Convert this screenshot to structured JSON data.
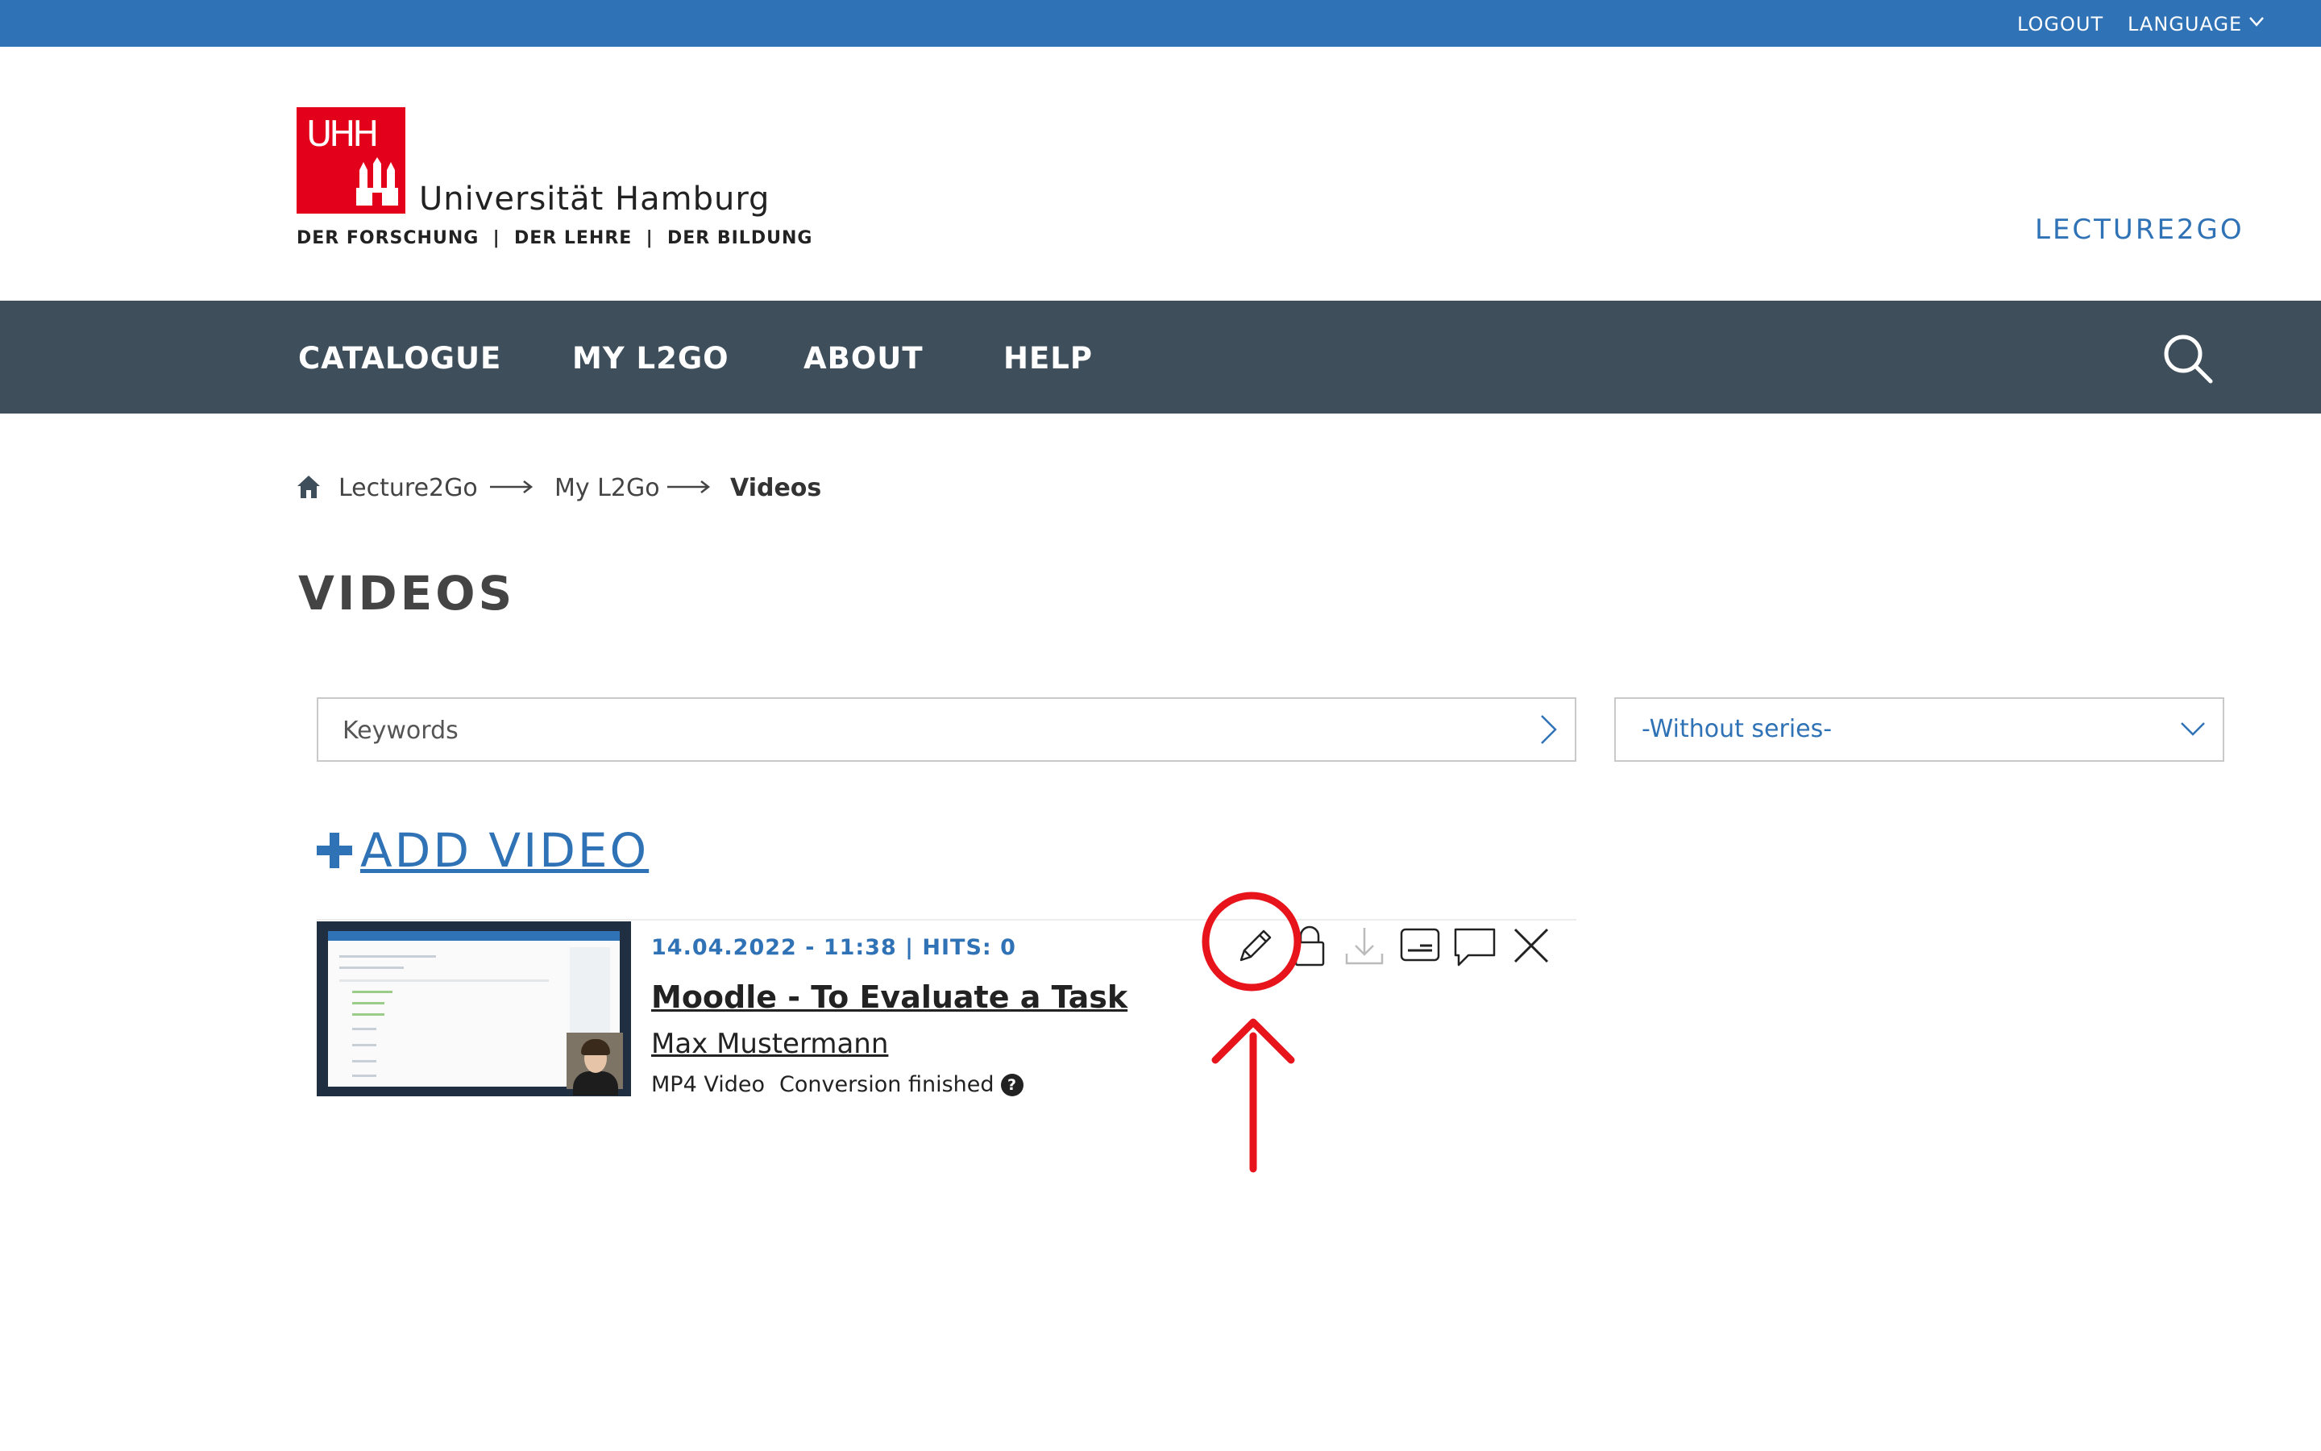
{
  "topbar": {
    "logout": "LOGOUT",
    "language": "LANGUAGE"
  },
  "header": {
    "logo_mark": "UHH",
    "university": "Universität Hamburg",
    "tagline": "DER FORSCHUNG  |  DER LEHRE  |  DER BILDUNG",
    "brand": "LECTURE2GO"
  },
  "nav": {
    "items": [
      "CATALOGUE",
      "MY L2GO",
      "ABOUT",
      "HELP"
    ]
  },
  "breadcrumb": [
    "Lecture2Go",
    "My L2Go",
    "Videos"
  ],
  "page": {
    "title": "VIDEOS"
  },
  "filters": {
    "keywords_placeholder": "Keywords",
    "series_value": "-Without series-"
  },
  "add_video": {
    "label": "ADD VIDEO"
  },
  "video": {
    "meta": "14.04.2022 - 11:38 | HITS: 0",
    "title": "Moodle - To Evaluate a Task",
    "author": "Max Mustermann",
    "format": "MP4 Video",
    "status": "Conversion finished",
    "help": "?"
  },
  "colors": {
    "topbar": "#2f72b5",
    "nav": "#3e4e5a",
    "logo": "#e2001a",
    "accent": "#2f72b5",
    "annotation": "#e8141b"
  },
  "icons": [
    "chevron-down-icon",
    "search-icon",
    "home-icon",
    "arrow-right-icon",
    "chevron-right-icon",
    "plus-icon",
    "edit-icon",
    "lock-icon",
    "download-icon",
    "subtitles-icon",
    "comment-icon",
    "close-icon"
  ]
}
